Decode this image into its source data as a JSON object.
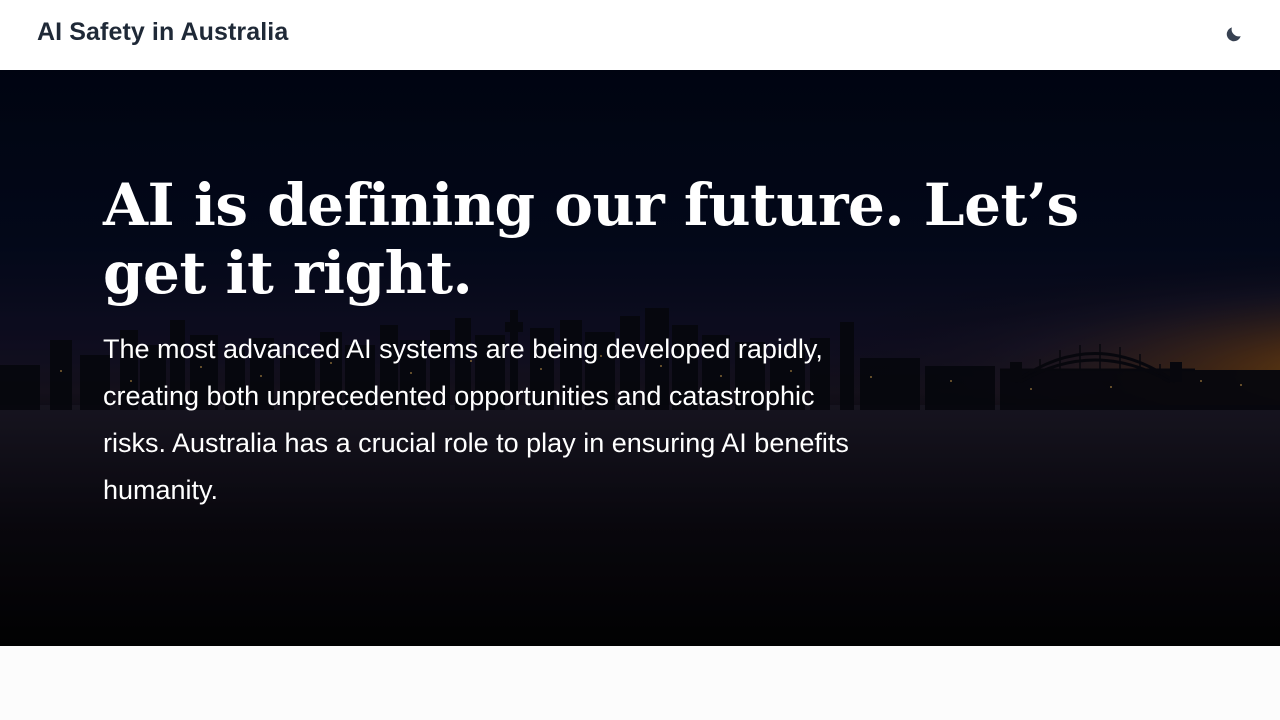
{
  "header": {
    "site_title": "AI Safety in Australia",
    "theme_toggle_icon": "moon-icon"
  },
  "hero": {
    "heading": "AI is defining our future. Let’s get it right.",
    "body": "The most advanced AI systems are being developed rapidly, creating both unprecedented opportunities and catastrophic risks. Australia has a crucial role to play in ensuring AI benefits humanity.",
    "background_image": "sydney-harbour-skyline-at-dusk"
  },
  "colors": {
    "header_bg": "#ffffff",
    "title_text": "#1f2937",
    "hero_text": "#ffffff",
    "sunset_orange": "#c27a12",
    "night_sky": "#030820"
  }
}
